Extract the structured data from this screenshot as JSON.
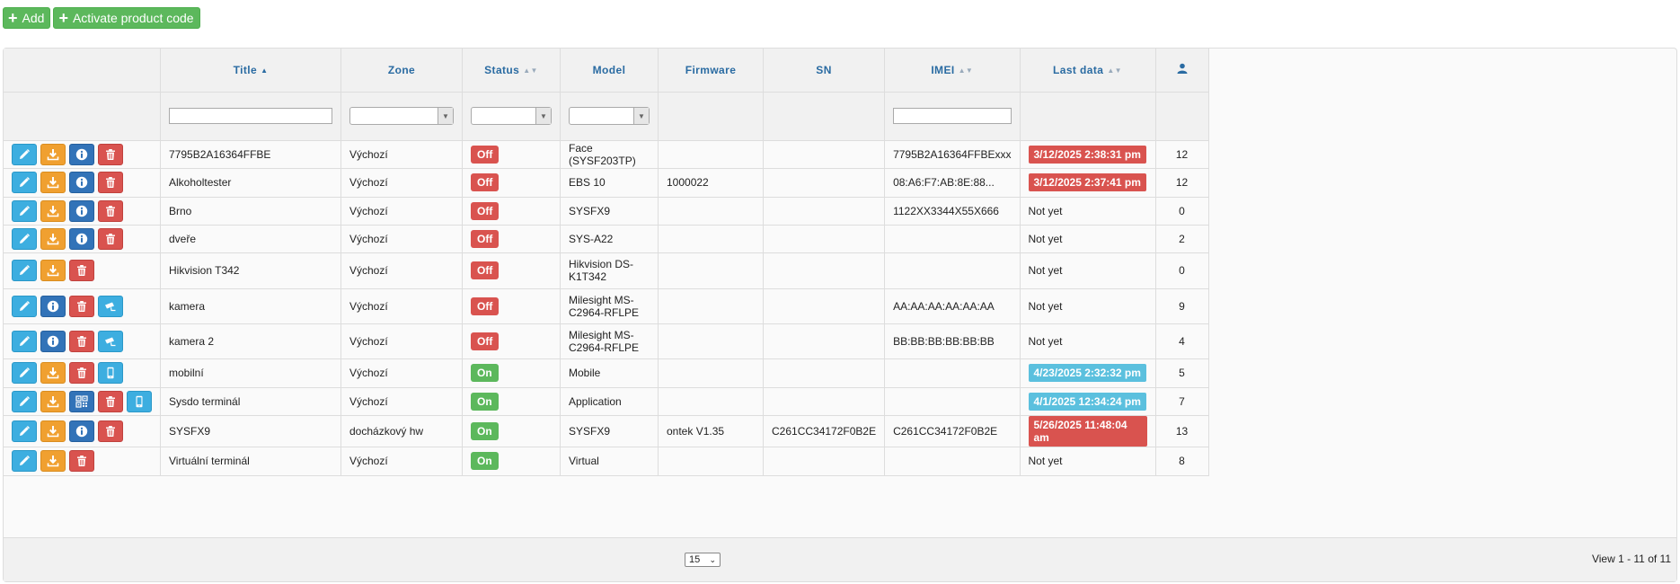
{
  "toolbar": {
    "add_label": "Add",
    "activate_label": "Activate product code"
  },
  "columns": [
    "Title",
    "Zone",
    "Status",
    "Model",
    "Firmware",
    "SN",
    "IMEI",
    "Last data"
  ],
  "rows": [
    {
      "actions": [
        "edit",
        "download",
        "info",
        "delete"
      ],
      "title": "7795B2A16364FFBE",
      "zone": "Výchozí",
      "status": "Off",
      "model": "Face (SYSF203TP)",
      "firmware": "",
      "sn": "",
      "imei": "7795B2A16364FFBExxx",
      "last": "3/12/2025 2:38:31 pm",
      "last_style": "red",
      "users": "12"
    },
    {
      "actions": [
        "edit",
        "download",
        "info",
        "delete"
      ],
      "title": "Alkoholtester",
      "zone": "Výchozí",
      "status": "Off",
      "model": "EBS 10",
      "firmware": "1000022",
      "sn": "",
      "imei": "08:A6:F7:AB:8E:88...",
      "last": "3/12/2025 2:37:41 pm",
      "last_style": "red",
      "users": "12"
    },
    {
      "actions": [
        "edit",
        "download",
        "info",
        "delete"
      ],
      "title": "Brno",
      "zone": "Výchozí",
      "status": "Off",
      "model": "SYSFX9",
      "firmware": "",
      "sn": "",
      "imei": "1122XX3344X55X666",
      "last": "Not yet",
      "last_style": "plain",
      "users": "0"
    },
    {
      "actions": [
        "edit",
        "download",
        "info",
        "delete"
      ],
      "title": "dveře",
      "zone": "Výchozí",
      "status": "Off",
      "model": "SYS-A22",
      "firmware": "",
      "sn": "",
      "imei": "",
      "last": "Not yet",
      "last_style": "plain",
      "users": "2"
    },
    {
      "actions": [
        "edit",
        "download",
        "delete"
      ],
      "title": "Hikvision T342",
      "zone": "Výchozí",
      "status": "Off",
      "model": "Hikvision DS-K1T342",
      "firmware": "",
      "sn": "",
      "imei": "",
      "last": "Not yet",
      "last_style": "plain",
      "users": "0"
    },
    {
      "actions": [
        "edit",
        "info",
        "delete",
        "camera"
      ],
      "title": "kamera",
      "zone": "Výchozí",
      "status": "Off",
      "model": "Milesight MS-C2964-RFLPE",
      "firmware": "",
      "sn": "",
      "imei": "AA:AA:AA:AA:AA:AA",
      "last": "Not yet",
      "last_style": "plain",
      "users": "9"
    },
    {
      "actions": [
        "edit",
        "info",
        "delete",
        "camera"
      ],
      "title": "kamera 2",
      "zone": "Výchozí",
      "status": "Off",
      "model": "Milesight MS-C2964-RFLPE",
      "firmware": "",
      "sn": "",
      "imei": "BB:BB:BB:BB:BB:BB",
      "last": "Not yet",
      "last_style": "plain",
      "users": "4"
    },
    {
      "actions": [
        "edit",
        "download",
        "delete",
        "mobile"
      ],
      "title": "mobilní",
      "zone": "Výchozí",
      "status": "On",
      "model": "Mobile",
      "firmware": "",
      "sn": "",
      "imei": "",
      "last": "4/23/2025 2:32:32 pm",
      "last_style": "blue",
      "users": "5"
    },
    {
      "actions": [
        "edit",
        "download",
        "qr",
        "delete",
        "mobile"
      ],
      "title": "Sysdo terminál",
      "zone": "Výchozí",
      "status": "On",
      "model": "Application",
      "firmware": "",
      "sn": "",
      "imei": "",
      "last": "4/1/2025 12:34:24 pm",
      "last_style": "blue",
      "users": "7"
    },
    {
      "actions": [
        "edit",
        "download",
        "info",
        "delete"
      ],
      "title": "SYSFX9",
      "zone": "docházkový hw",
      "status": "On",
      "model": "SYSFX9",
      "firmware": "ontek V1.35",
      "sn": "C261CC34172F0B2E",
      "imei": "C261CC34172F0B2E",
      "last": "5/26/2025 11:48:04 am",
      "last_style": "red",
      "users": "13"
    },
    {
      "actions": [
        "edit",
        "download",
        "delete"
      ],
      "title": "Virtuální terminál",
      "zone": "Výchozí",
      "status": "On",
      "model": "Virtual",
      "firmware": "",
      "sn": "",
      "imei": "",
      "last": "Not yet",
      "last_style": "plain",
      "users": "8"
    }
  ],
  "pager": {
    "page_size": "15",
    "view_info": "View 1 - 11 of 11"
  },
  "colors": {
    "red": "#d9534f",
    "green": "#5cb85c",
    "blue": "#5bc0de",
    "header_text": "#2a6ba2"
  }
}
